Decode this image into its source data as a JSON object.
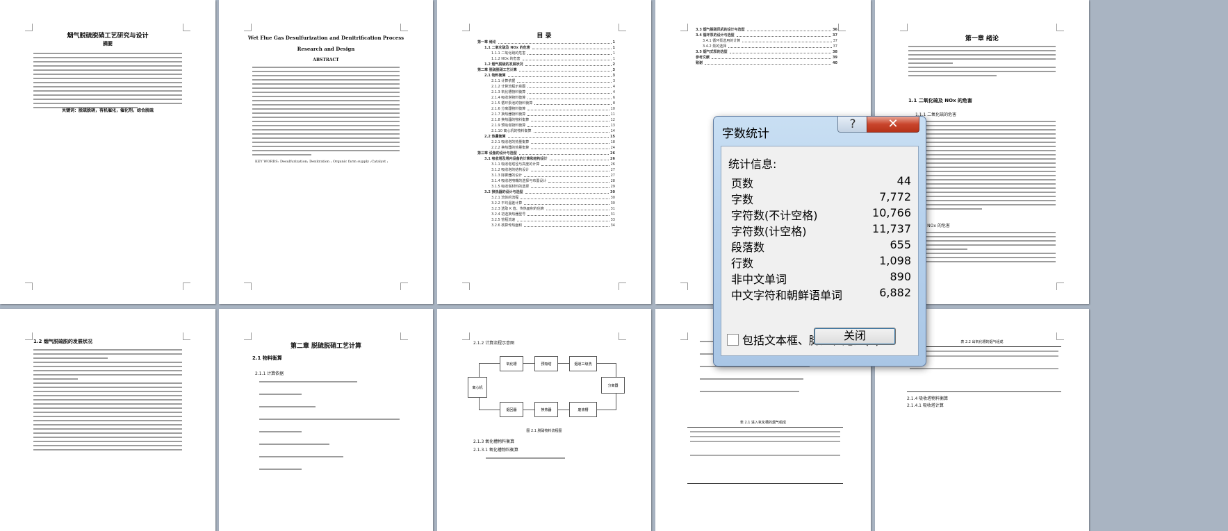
{
  "pages": {
    "p1_title": "烟气脱硫脱硝工艺研究与设计",
    "p1_abstract_heading": "摘要",
    "p1_keywords": "关键词：脱硫脱硝，有机催化，催化剂，综合脱硫",
    "p2_title_line1": "Wet Flue Gas Desulfurization and Denitrification Process",
    "p2_title_line2": "Research and Design",
    "p2_abstract_heading": "ABSTRACT",
    "p2_keywords": "KEY WORDS: Desulfurization; Denitration ; Organic farm supply ;Catalyst ;",
    "p3_toc_heading": "目  录",
    "p4_toc_tail": [
      {
        "label": "3.3 烟气脱硝风机的设计与选型",
        "page": "36"
      },
      {
        "label": "3.4 循环泵的设计与选型",
        "page": "37"
      },
      {
        "label": "3.4.1 循环泵选用的计算",
        "page": "37"
      },
      {
        "label": "3.4.2 泵的选择",
        "page": "37"
      },
      {
        "label": "3.5 烟气式泵的选型",
        "page": "38"
      },
      {
        "label": "参考文献",
        "page": "39"
      },
      {
        "label": "致谢",
        "page": "40"
      }
    ],
    "p5_chapter": "第一章  绪论",
    "p5_section": "1.1 二氧化硫及 NOx 的危害",
    "p5_sub1": "1.1.1 二氧化硫的危害",
    "p5_sub2": "1.1.2 NOx 的危害",
    "p6_section": "1.2 烟气脱硫脱的发展状况",
    "p7_chapter": "第二章  脱硫脱硝工艺计算",
    "p7_section": "2.1 物料衡算",
    "p7_sub": "2.1.1 计算依据",
    "p8_sub": "2.1.2 计算流程示意图",
    "p8_caption": "图 2.1 脱硝物料流程图",
    "p8_sub2": "2.1.3 氧化槽物料衡算",
    "p8_sub3": "2.1.3.1 氧化槽物料衡算",
    "p9_caption": "表 2.1 进入氧化槽的烟气组成",
    "p10_caption": "表 2.2 出氧化槽的烟气组成",
    "p10_sub": "2.1.4 吸收塔物料衡算",
    "p10_sub2": "2.1.4.1 吸收塔计算",
    "flow_boxes": [
      "离心机",
      "氧化槽",
      "预吸塔",
      "烟道三级洗",
      "分离器",
      "烟回器",
      "换热器",
      "废液槽"
    ]
  },
  "toc": [
    {
      "label": "第一章  绪论",
      "page": "1",
      "bold": true,
      "indent": 0
    },
    {
      "label": "1.1 二氧化硫及 NOx 的危害",
      "page": "1",
      "bold": true,
      "indent": 1
    },
    {
      "label": "1.1.1 二氧化硫的危害",
      "page": "1",
      "bold": false,
      "indent": 2
    },
    {
      "label": "1.1.2 NOx 的危害",
      "page": "1",
      "bold": false,
      "indent": 2
    },
    {
      "label": "1.2 烟气脱硫的发展状况",
      "page": "2",
      "bold": true,
      "indent": 1
    },
    {
      "label": "第二章  脱硫脱硝工艺计算",
      "page": "3",
      "bold": true,
      "indent": 0
    },
    {
      "label": "2.1 物料衡算",
      "page": "3",
      "bold": true,
      "indent": 1
    },
    {
      "label": "2.1.1 计算依据",
      "page": "3",
      "bold": false,
      "indent": 2
    },
    {
      "label": "2.1.2 计算流程示意图",
      "page": "4",
      "bold": false,
      "indent": 2
    },
    {
      "label": "2.1.3 氧化槽物料衡算",
      "page": "4",
      "bold": false,
      "indent": 2
    },
    {
      "label": "2.1.4 吸收塔物料衡算",
      "page": "6",
      "bold": false,
      "indent": 2
    },
    {
      "label": "2.1.5 循环泵池的物料衡算",
      "page": "8",
      "bold": false,
      "indent": 2
    },
    {
      "label": "2.1.6 分离器物料衡算",
      "page": "10",
      "bold": false,
      "indent": 2
    },
    {
      "label": "2.1.7 换热器物料衡算",
      "page": "11",
      "bold": false,
      "indent": 2
    },
    {
      "label": "2.1.8 换热器的物料衡算",
      "page": "12",
      "bold": false,
      "indent": 2
    },
    {
      "label": "2.1.9 预吸塔物料衡算",
      "page": "13",
      "bold": false,
      "indent": 2
    },
    {
      "label": "2.1.10 离心机的物料衡算",
      "page": "14",
      "bold": false,
      "indent": 2
    },
    {
      "label": "2.2 热量衡算",
      "page": "15",
      "bold": true,
      "indent": 1
    },
    {
      "label": "2.2.1 吸收塔的热量衡算",
      "page": "18",
      "bold": false,
      "indent": 2
    },
    {
      "label": "2.2.2 换热器的热量衡算",
      "page": "24",
      "bold": false,
      "indent": 2
    },
    {
      "label": "第三章  设备的设计与选型",
      "page": "26",
      "bold": true,
      "indent": 0
    },
    {
      "label": "3.1 吸收塔及塔内设备的计算和结构设计",
      "page": "26",
      "bold": true,
      "indent": 1
    },
    {
      "label": "3.1.1 吸收塔塔径与高度的计算",
      "page": "26",
      "bold": false,
      "indent": 2
    },
    {
      "label": "3.1.2 吸收塔的结构设计",
      "page": "27",
      "bold": false,
      "indent": 2
    },
    {
      "label": "3.1.3 除雾器的设计",
      "page": "27",
      "bold": false,
      "indent": 2
    },
    {
      "label": "3.1.4 吸收塔喷嘴的选择与布置设计",
      "page": "28",
      "bold": false,
      "indent": 2
    },
    {
      "label": "3.1.5 吸收塔材料的选择",
      "page": "29",
      "bold": false,
      "indent": 2
    },
    {
      "label": "3.2 换热器的设计与选型",
      "page": "30",
      "bold": true,
      "indent": 1
    },
    {
      "label": "3.2.1 流体的流程",
      "page": "30",
      "bold": false,
      "indent": 2
    },
    {
      "label": "3.2.2 平均温差计算",
      "page": "30",
      "bold": false,
      "indent": 2
    },
    {
      "label": "3.2.3 选取 K 值、传热面积的估算",
      "page": "31",
      "bold": false,
      "indent": 2
    },
    {
      "label": "3.2.4 初选换热器型号",
      "page": "31",
      "bold": false,
      "indent": 2
    },
    {
      "label": "3.2.5 管程流速",
      "page": "33",
      "bold": false,
      "indent": 2
    },
    {
      "label": "3.2.6 核算传热面积",
      "page": "34",
      "bold": false,
      "indent": 2
    }
  ],
  "dialog": {
    "title": "字数统计",
    "help_symbol": "?",
    "close_symbol": "✕",
    "stats_heading": "统计信息:",
    "rows": [
      {
        "label": "页数",
        "value": "44"
      },
      {
        "label": "字数",
        "value": "7,772"
      },
      {
        "label": "字符数(不计空格)",
        "value": "10,766"
      },
      {
        "label": "字符数(计空格)",
        "value": "11,737"
      },
      {
        "label": "段落数",
        "value": "655"
      },
      {
        "label": "行数",
        "value": "1,098"
      },
      {
        "label": "非中文单词",
        "value": "890"
      },
      {
        "label": "中文字符和朝鲜语单词",
        "value": "6,882"
      }
    ],
    "checkbox_label": "包括文本框、脚注和尾注(F)",
    "checkbox_checked": false,
    "close_button": "关闭"
  }
}
